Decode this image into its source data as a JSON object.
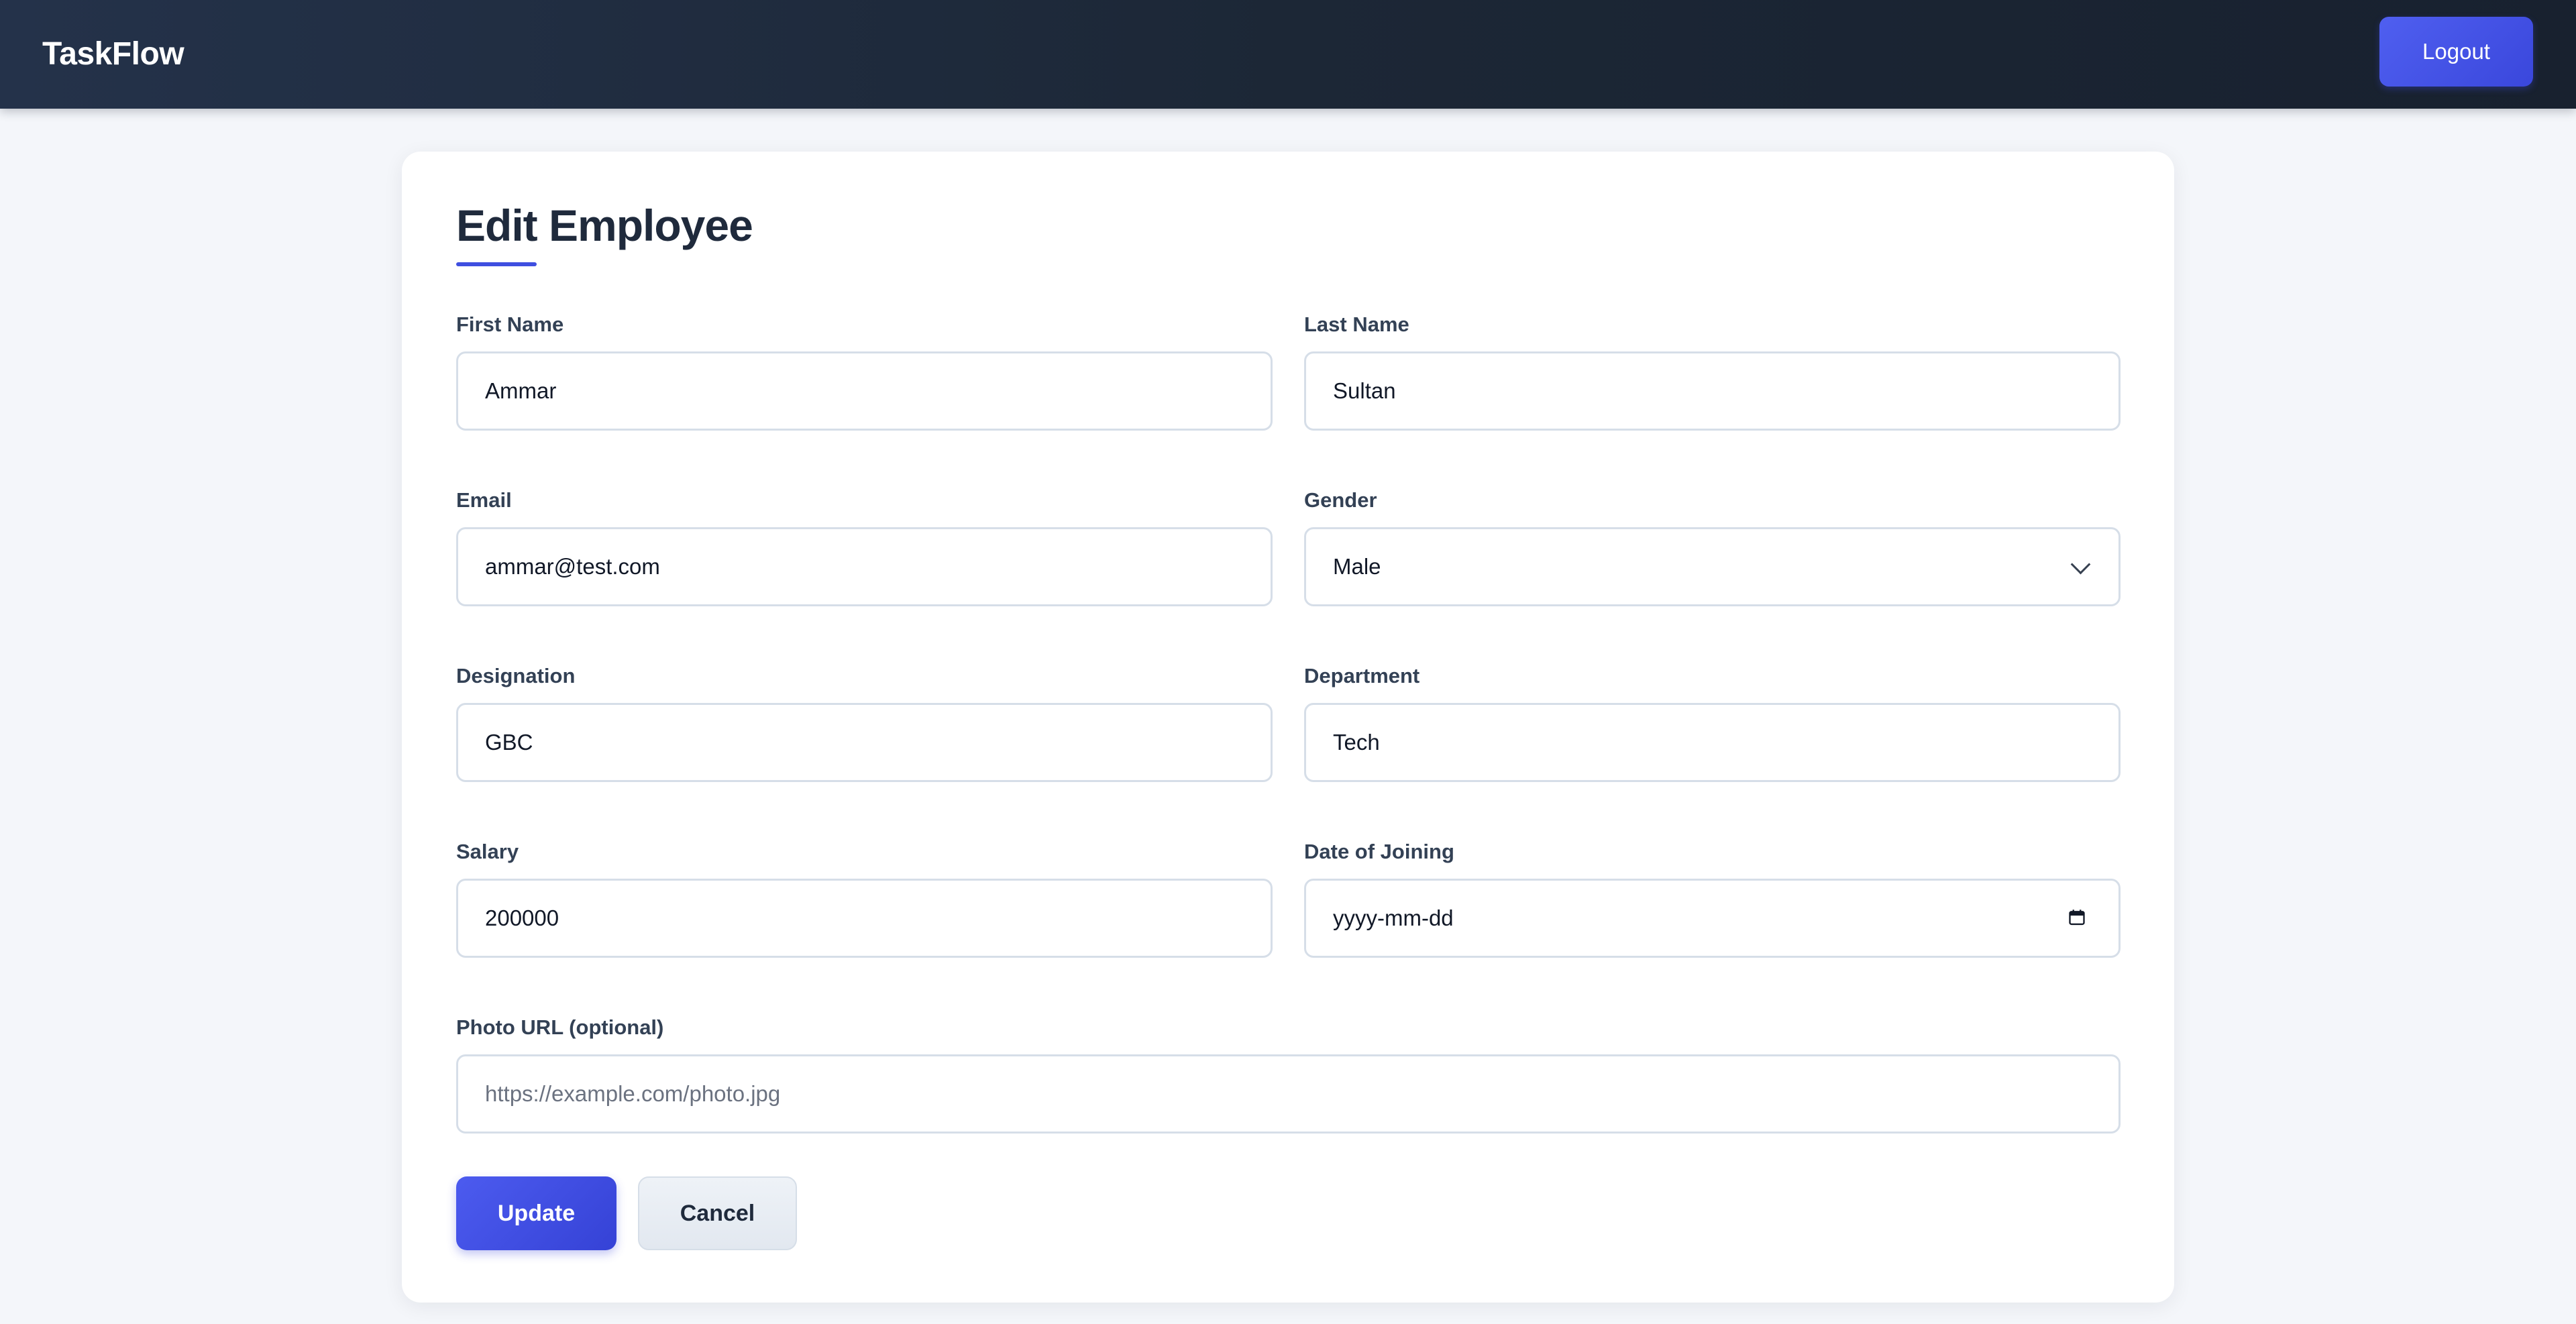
{
  "header": {
    "brand": "TaskFlow",
    "logout_label": "Logout"
  },
  "form": {
    "title": "Edit Employee",
    "first_name": {
      "label": "First Name",
      "value": "Ammar"
    },
    "last_name": {
      "label": "Last Name",
      "value": "Sultan"
    },
    "email": {
      "label": "Email",
      "value": "ammar@test.com"
    },
    "gender": {
      "label": "Gender",
      "value": "Male"
    },
    "designation": {
      "label": "Designation",
      "value": "GBC"
    },
    "department": {
      "label": "Department",
      "value": "Tech"
    },
    "salary": {
      "label": "Salary",
      "value": "200000"
    },
    "date_of_joining": {
      "label": "Date of Joining",
      "placeholder": "yyyy-mm-dd"
    },
    "photo_url": {
      "label": "Photo URL (optional)",
      "placeholder": "https://example.com/photo.jpg"
    },
    "update_label": "Update",
    "cancel_label": "Cancel"
  },
  "colors": {
    "header_bg": "#1c2736",
    "accent": "#3f4fe0",
    "input_border": "#d6dee8",
    "page_bg": "#f4f6fa"
  }
}
